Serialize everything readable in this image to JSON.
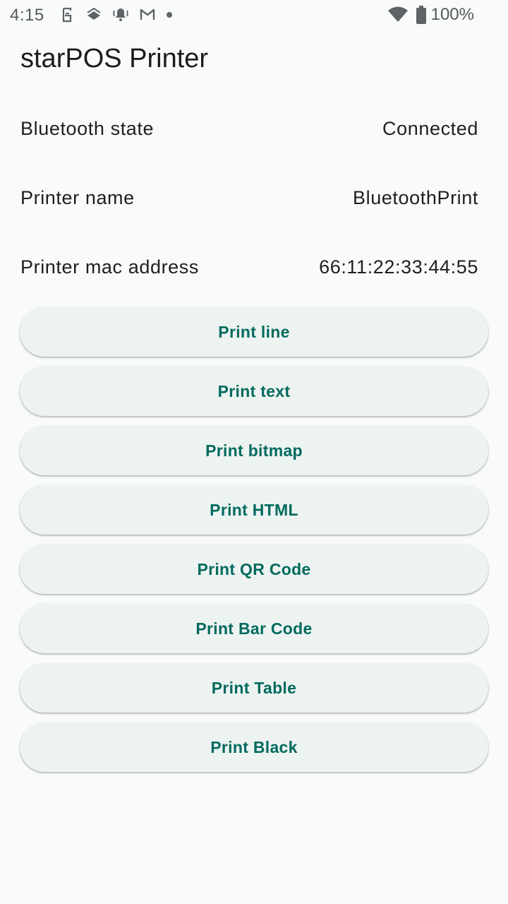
{
  "status_bar": {
    "time": "4:15",
    "notification_icons": [
      "s-badge-icon",
      "stack-icon",
      "ringing-bell-icon",
      "gmail-icon",
      "dot-icon"
    ],
    "battery": "100%"
  },
  "app": {
    "title": "starPOS Printer",
    "accent_color": "#006a5e"
  },
  "info": {
    "bluetooth_state": {
      "label": "Bluetooth state",
      "value": "Connected"
    },
    "printer_name": {
      "label": "Printer name",
      "value": "BluetoothPrint"
    },
    "printer_mac": {
      "label": "Printer mac address",
      "value": "66:11:22:33:44:55"
    }
  },
  "buttons": {
    "print_line": "Print line",
    "print_text": "Print text",
    "print_bitmap": "Print bitmap",
    "print_html": "Print HTML",
    "print_qr": "Print QR Code",
    "print_barcode": "Print Bar Code",
    "print_table": "Print Table",
    "print_black": "Print Black"
  }
}
